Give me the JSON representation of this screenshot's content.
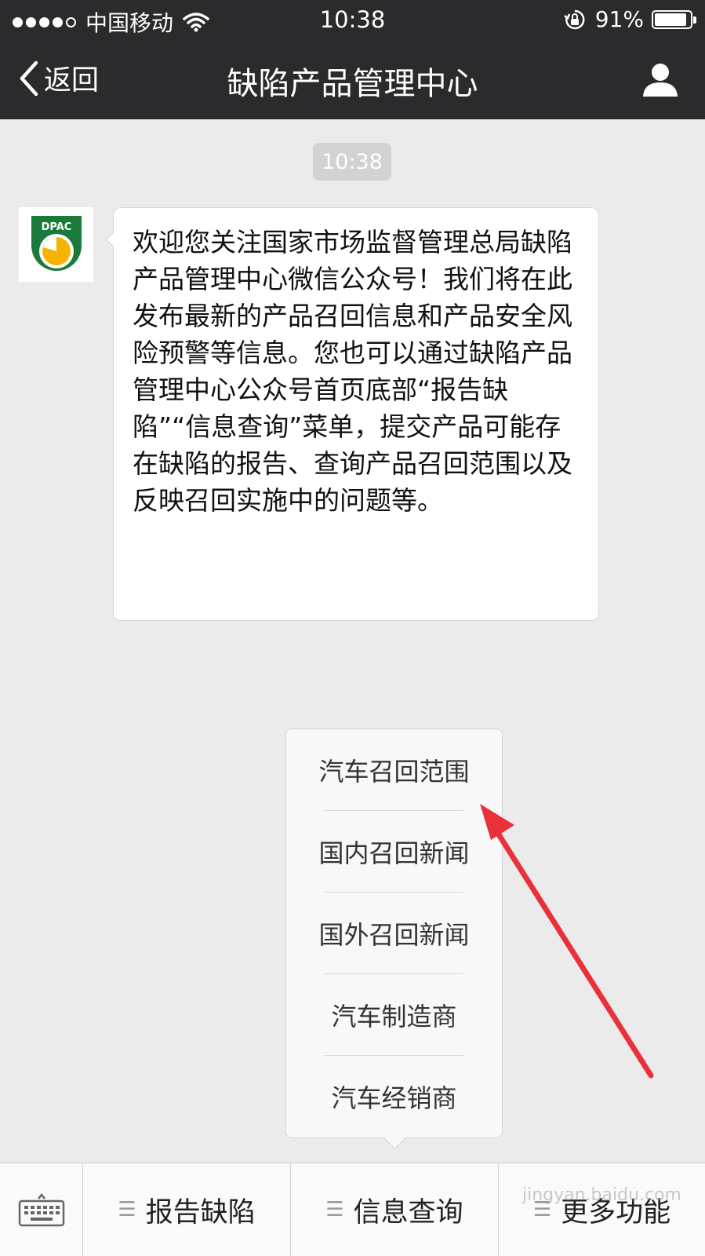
{
  "status_bar": {
    "carrier": "中国移动",
    "time": "10:38",
    "battery": "91%",
    "battery_level": 0.91
  },
  "nav": {
    "back_label": "返回",
    "title": "缺陷产品管理中心"
  },
  "chat": {
    "timestamp": "10:38",
    "sender_logo_text": "DPAC",
    "message": "欢迎您关注国家市场监督管理总局缺陷产品管理中心微信公众号！我们将在此发布最新的产品召回信息和产品安全风险预警等信息。您也可以通过缺陷产品管理中心公众号首页底部“报告缺陷”“信息查询”菜单，提交产品可能存在缺陷的报告、查询产品召回范围以及反映召回实施中的问题等。"
  },
  "popup_menu": {
    "items": [
      "汽车召回范围",
      "国内召回新闻",
      "国外召回新闻",
      "汽车制造商",
      "汽车经销商"
    ]
  },
  "bottom_menu": {
    "tabs": [
      "报告缺陷",
      "信息查询",
      "更多功能"
    ]
  },
  "watermark": "jingyan.baidu.com",
  "colors": {
    "nav_bg": "#2b2b2d",
    "chat_bg": "#ebebeb",
    "arrow": "#e8313a",
    "logo_green": "#1a7a3a",
    "logo_yellow": "#f5b400"
  }
}
